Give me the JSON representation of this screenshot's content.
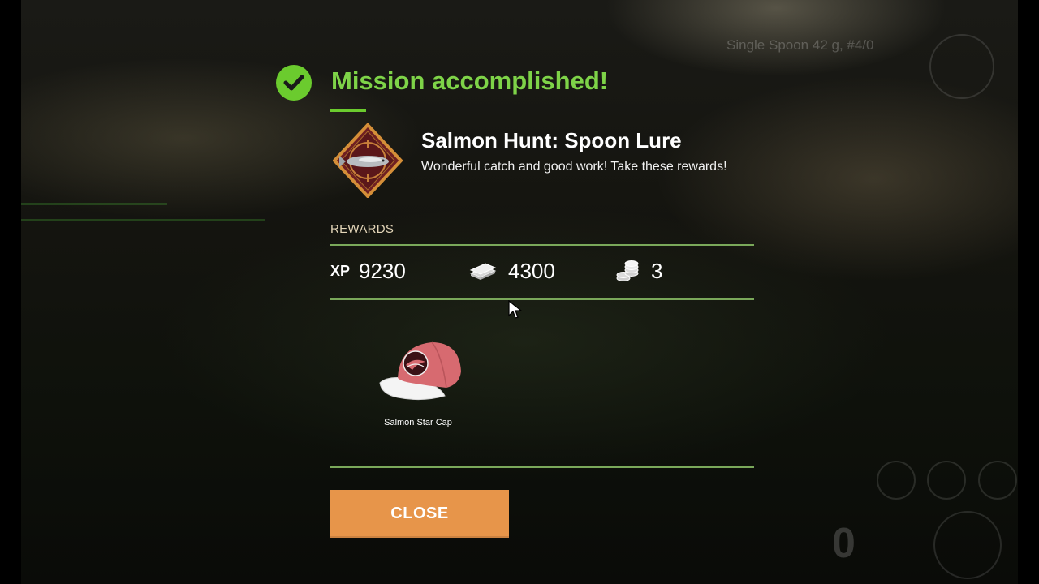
{
  "hud": {
    "lure_text": "Single Spoon 42 g, #4/0",
    "score": "0"
  },
  "dialog": {
    "title": "Mission accomplished!",
    "mission_name": "Salmon Hunt: Spoon Lure",
    "mission_description": "Wonderful catch and good work! Take these rewards!",
    "rewards_label": "REWARDS",
    "xp_label": "XP",
    "xp_value": "9230",
    "money_value": "4300",
    "coins_value": "3",
    "item": {
      "name": "Salmon Star Cap",
      "icon": "cap-icon"
    },
    "close_label": "CLOSE"
  },
  "colors": {
    "accent_green": "#7ed348",
    "separator": "#7aa85a",
    "close_button": "#e7954a",
    "rewards_label": "#e3d5b8"
  },
  "icons": [
    "check-icon",
    "salmon-badge-icon",
    "money-icon",
    "coins-icon",
    "cap-icon",
    "cursor-icon"
  ]
}
